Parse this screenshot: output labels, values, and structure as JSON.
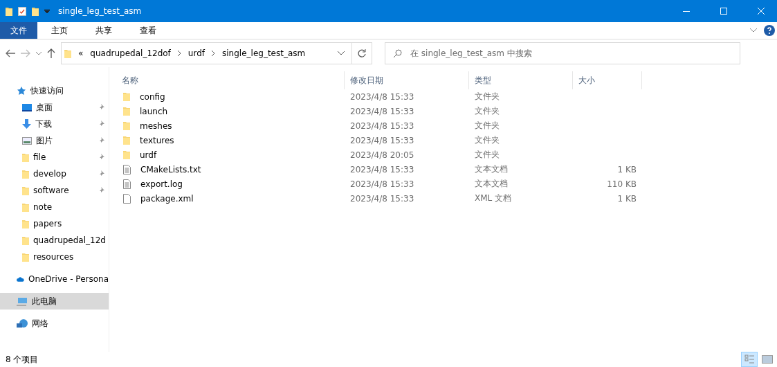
{
  "window": {
    "title": "single_leg_test_asm"
  },
  "ribbon": {
    "tabs": [
      {
        "label": "文件",
        "selected": true
      },
      {
        "label": "主页",
        "selected": false
      },
      {
        "label": "共享",
        "selected": false
      },
      {
        "label": "查看",
        "selected": false
      }
    ]
  },
  "address": {
    "path": [
      "quadrupedal_12dof",
      "urdf",
      "single_leg_test_asm"
    ],
    "prefix": "«"
  },
  "search": {
    "placeholder": "在 single_leg_test_asm 中搜索"
  },
  "sidebar": {
    "items": [
      {
        "label": "快速访问",
        "kind": "star",
        "selected": false,
        "children": [
          {
            "label": "桌面",
            "kind": "desktop",
            "pinned": true,
            "selected": false
          },
          {
            "label": "下载",
            "kind": "download",
            "pinned": true,
            "selected": false
          },
          {
            "label": "图片",
            "kind": "pictures",
            "pinned": true,
            "selected": false
          },
          {
            "label": "file",
            "kind": "folder",
            "pinned": true,
            "selected": false
          },
          {
            "label": "develop",
            "kind": "folder",
            "pinned": true,
            "selected": false
          },
          {
            "label": "software",
            "kind": "folder",
            "pinned": true,
            "selected": false
          },
          {
            "label": "note",
            "kind": "folder",
            "pinned": false,
            "selected": false
          },
          {
            "label": "papers",
            "kind": "folder",
            "pinned": false,
            "selected": false
          },
          {
            "label": "quadrupedal_12d",
            "kind": "folder",
            "pinned": false,
            "selected": false
          },
          {
            "label": "resources",
            "kind": "folder",
            "pinned": false,
            "selected": false
          }
        ]
      },
      {
        "label": "OneDrive - Persona",
        "kind": "cloud",
        "selected": false
      },
      {
        "label": "此电脑",
        "kind": "pc",
        "selected": true
      },
      {
        "label": "网络",
        "kind": "network",
        "selected": false
      }
    ]
  },
  "table": {
    "columns": [
      "名称",
      "修改日期",
      "类型",
      "大小"
    ],
    "rows": [
      {
        "name": "config",
        "date": "2023/4/8 15:33",
        "type": "文件夹",
        "kind": "folder"
      },
      {
        "name": "launch",
        "date": "2023/4/8 15:33",
        "type": "文件夹",
        "kind": "folder"
      },
      {
        "name": "meshes",
        "date": "2023/4/8 15:33",
        "type": "文件夹",
        "kind": "folder"
      },
      {
        "name": "textures",
        "date": "2023/4/8 15:33",
        "type": "文件夹",
        "kind": "folder"
      },
      {
        "name": "urdf",
        "date": "2023/4/8 20:05",
        "type": "文件夹",
        "kind": "folder"
      },
      {
        "name": "CMakeLists.txt",
        "date": "2023/4/8 15:33",
        "type": "文本文档",
        "size": "1 KB",
        "kind": "text"
      },
      {
        "name": "export.log",
        "date": "2023/4/8 15:33",
        "type": "文本文档",
        "size": "110 KB",
        "kind": "text"
      },
      {
        "name": "package.xml",
        "date": "2023/4/8 15:33",
        "type": "XML 文档",
        "size": "1 KB",
        "kind": "file"
      }
    ]
  },
  "status_bar": {
    "count": "8 个项目"
  }
}
